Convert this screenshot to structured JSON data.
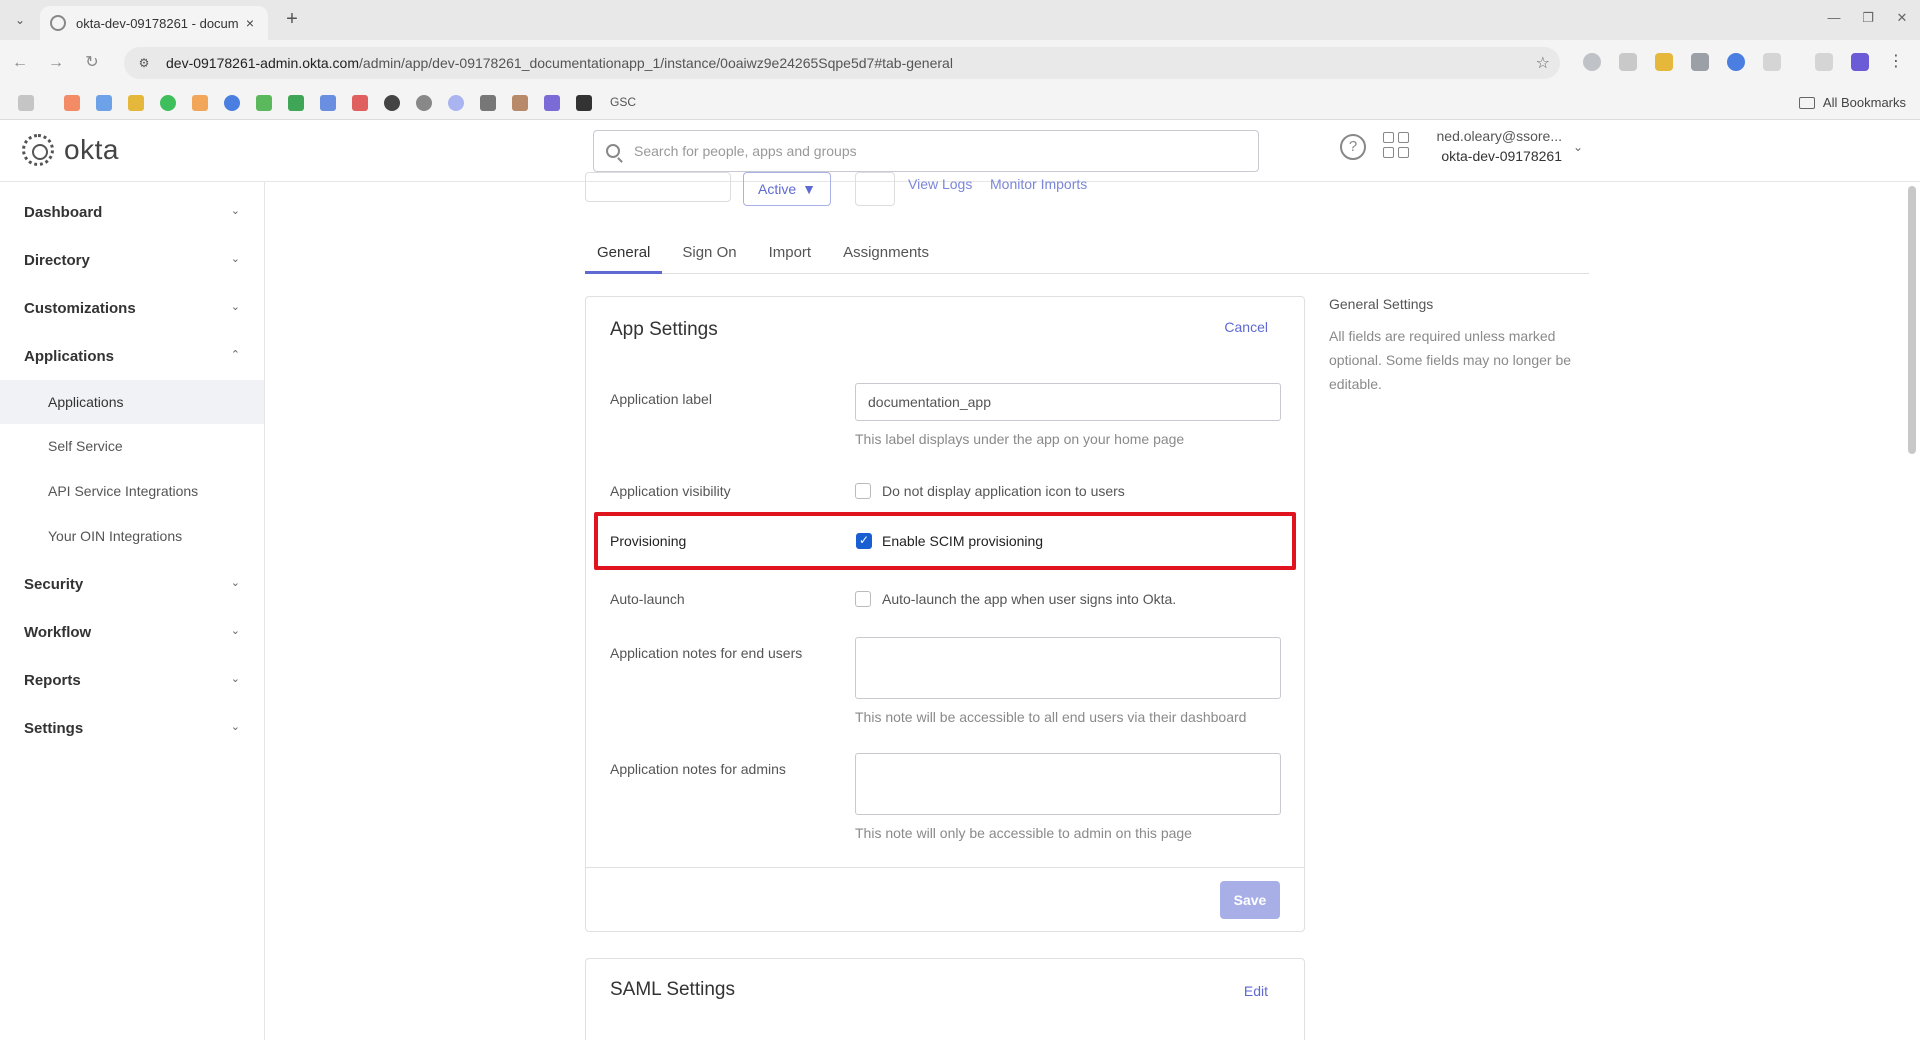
{
  "browser": {
    "tab_title": "okta-dev-09178261 - docum",
    "url_host": "dev-09178261-admin.okta.com",
    "url_path": "/admin/app/dev-09178261_documentationapp_1/instance/0oaiwz9e24265Sqpe5d7#tab-general",
    "bookmark_gsc": "GSC",
    "all_bookmarks": "All Bookmarks"
  },
  "header": {
    "logo_text": "okta",
    "search_placeholder": "Search for people, apps and groups",
    "user_email": "ned.oleary@ssore...",
    "org_name": "okta-dev-09178261"
  },
  "sidebar": {
    "items": [
      {
        "label": "Dashboard"
      },
      {
        "label": "Directory"
      },
      {
        "label": "Customizations"
      },
      {
        "label": "Applications"
      },
      {
        "label": "Security"
      },
      {
        "label": "Workflow"
      },
      {
        "label": "Reports"
      },
      {
        "label": "Settings"
      }
    ],
    "applications_sub": [
      {
        "label": "Applications"
      },
      {
        "label": "Self Service"
      },
      {
        "label": "API Service Integrations"
      },
      {
        "label": "Your OIN Integrations"
      }
    ]
  },
  "top_actions": {
    "status": "Active",
    "view_logs": "View Logs",
    "monitor_imports": "Monitor Imports"
  },
  "tabs": [
    {
      "label": "General"
    },
    {
      "label": "Sign On"
    },
    {
      "label": "Import"
    },
    {
      "label": "Assignments"
    }
  ],
  "app_settings": {
    "title": "App Settings",
    "cancel": "Cancel",
    "label_field_label": "Application label",
    "label_field_value": "documentation_app",
    "label_hint": "This label displays under the app on your home page",
    "visibility_label": "Application visibility",
    "visibility_checkbox": "Do not display application icon to users",
    "provisioning_label": "Provisioning",
    "provisioning_checkbox": "Enable SCIM provisioning",
    "autolaunch_label": "Auto-launch",
    "autolaunch_checkbox": "Auto-launch the app when user signs into Okta.",
    "notes_end_users_label": "Application notes for end users",
    "notes_end_users_hint": "This note will be accessible to all end users via their dashboard",
    "notes_admins_label": "Application notes for admins",
    "notes_admins_hint": "This note will only be accessible to admin on this page",
    "save": "Save"
  },
  "general_info": {
    "heading": "General Settings",
    "text": "All fields are required unless marked optional. Some fields may no longer be editable."
  },
  "saml_settings": {
    "title": "SAML Settings",
    "edit": "Edit"
  }
}
